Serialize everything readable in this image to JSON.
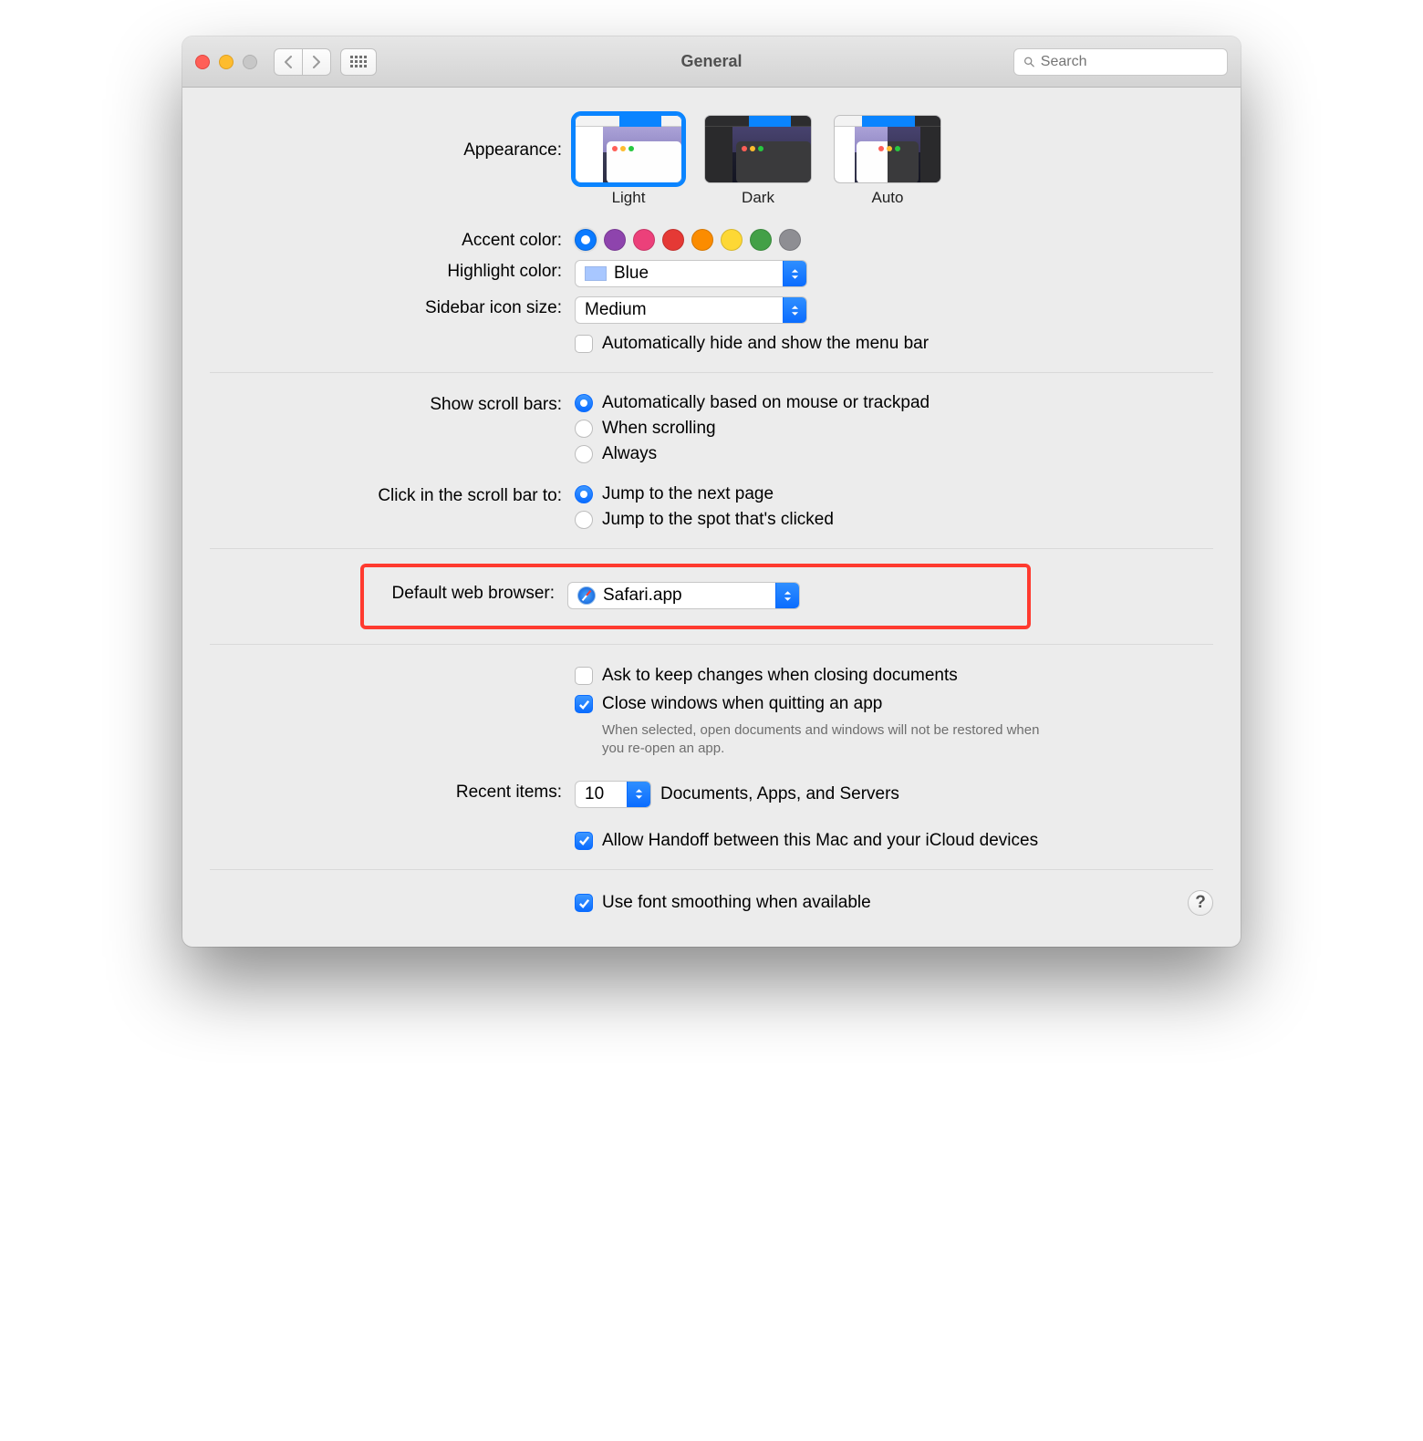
{
  "window": {
    "title": "General"
  },
  "toolbar": {
    "search_placeholder": "Search"
  },
  "appearance": {
    "label": "Appearance:",
    "options": [
      "Light",
      "Dark",
      "Auto"
    ],
    "selected": "Light"
  },
  "accent": {
    "label": "Accent color:",
    "colors": [
      "#0a7aff",
      "#8e44ad",
      "#ec407a",
      "#e53935",
      "#fb8c00",
      "#fdd835",
      "#43a047",
      "#8e8e93"
    ],
    "selected_index": 0
  },
  "highlight": {
    "label": "Highlight color:",
    "value": "Blue"
  },
  "sidebar_icon": {
    "label": "Sidebar icon size:",
    "value": "Medium"
  },
  "menubar_hide": {
    "label": "Automatically hide and show the menu bar",
    "checked": false
  },
  "scrollbars": {
    "label": "Show scroll bars:",
    "options": [
      "Automatically based on mouse or trackpad",
      "When scrolling",
      "Always"
    ],
    "selected_index": 0
  },
  "scrollclick": {
    "label": "Click in the scroll bar to:",
    "options": [
      "Jump to the next page",
      "Jump to the spot that's clicked"
    ],
    "selected_index": 0
  },
  "default_browser": {
    "label": "Default web browser:",
    "value": "Safari.app"
  },
  "ask_keep": {
    "label": "Ask to keep changes when closing documents",
    "checked": false
  },
  "close_windows": {
    "label": "Close windows when quitting an app",
    "checked": true,
    "note": "When selected, open documents and windows will not be restored when you re-open an app."
  },
  "recent": {
    "label": "Recent items:",
    "value": "10",
    "suffix": "Documents, Apps, and Servers"
  },
  "handoff": {
    "label": "Allow Handoff between this Mac and your iCloud devices",
    "checked": true
  },
  "font_smoothing": {
    "label": "Use font smoothing when available",
    "checked": true
  }
}
